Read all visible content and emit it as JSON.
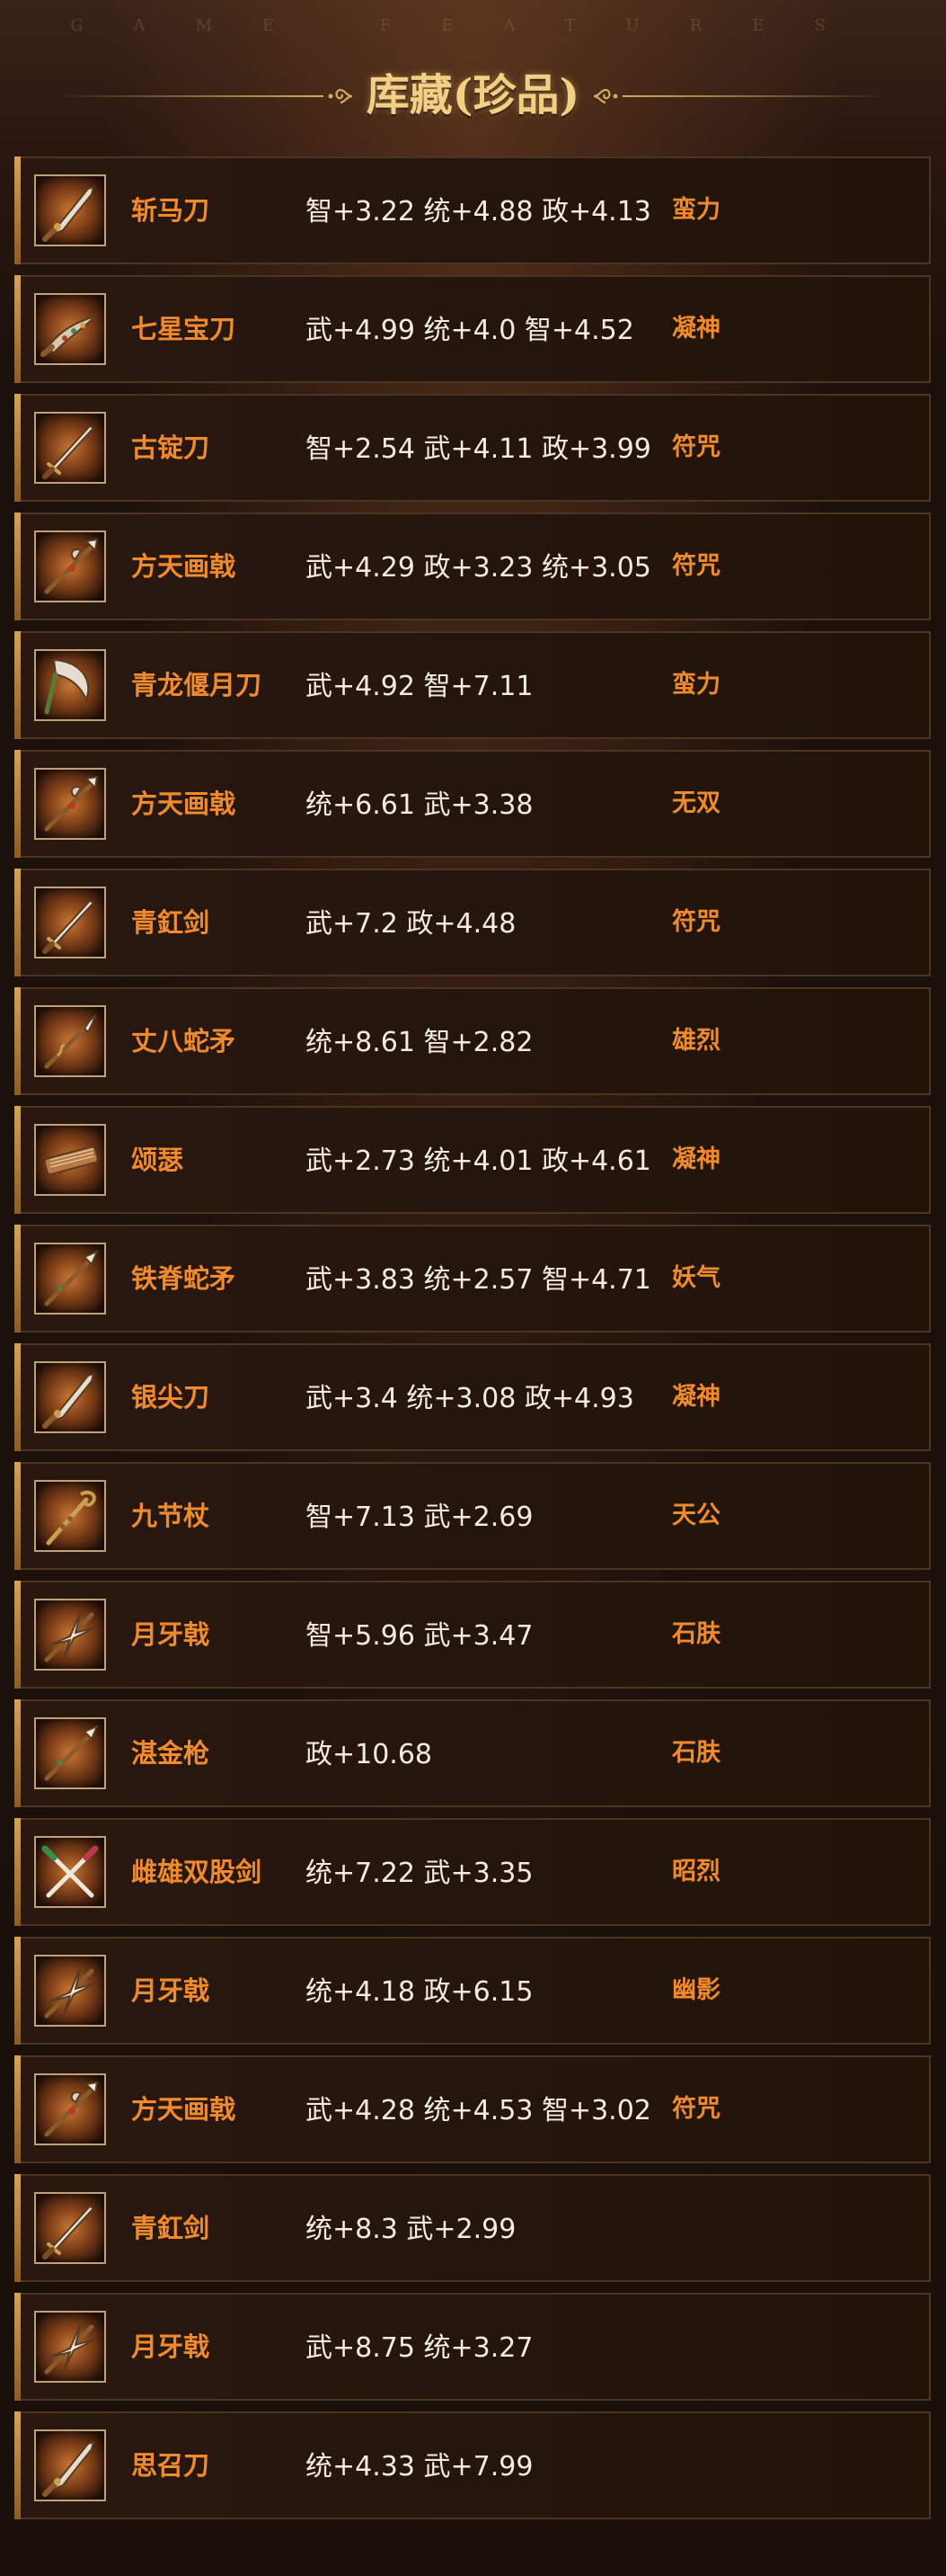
{
  "header": {
    "watermark": "GAME FEATURES",
    "title": "库藏(珍品)"
  },
  "items": [
    {
      "name": "斩马刀",
      "stats": "智+3.22 统+4.88 政+4.13",
      "trait": "蛮力",
      "icon": "blade-icon"
    },
    {
      "name": "七星宝刀",
      "stats": "武+4.99 统+4.0 智+4.52",
      "trait": "凝神",
      "icon": "jeweled-sword-icon"
    },
    {
      "name": "古锭刀",
      "stats": "智+2.54 武+4.11 政+3.99",
      "trait": "符咒",
      "icon": "sword-icon"
    },
    {
      "name": "方天画戟",
      "stats": "武+4.29 政+3.23 统+3.05",
      "trait": "符咒",
      "icon": "halberd-icon"
    },
    {
      "name": "青龙偃月刀",
      "stats": "武+4.92 智+7.11",
      "trait": "蛮力",
      "icon": "crescent-blade-icon"
    },
    {
      "name": "方天画戟",
      "stats": "统+6.61 武+3.38",
      "trait": "无双",
      "icon": "halberd-icon"
    },
    {
      "name": "青釭剑",
      "stats": "武+7.2 政+4.48",
      "trait": "符咒",
      "icon": "sword-icon"
    },
    {
      "name": "丈八蛇矛",
      "stats": "统+8.61 智+2.82",
      "trait": "雄烈",
      "icon": "serpent-spear-icon"
    },
    {
      "name": "颂瑟",
      "stats": "武+2.73 统+4.01 政+4.61",
      "trait": "凝神",
      "icon": "zither-icon"
    },
    {
      "name": "铁脊蛇矛",
      "stats": "武+3.83 统+2.57 智+4.71",
      "trait": "妖气",
      "icon": "spear-icon"
    },
    {
      "name": "银尖刀",
      "stats": "武+3.4 统+3.08 政+4.93",
      "trait": "凝神",
      "icon": "blade-icon"
    },
    {
      "name": "九节杖",
      "stats": "智+7.13 武+2.69",
      "trait": "天公",
      "icon": "staff-icon"
    },
    {
      "name": "月牙戟",
      "stats": "智+5.96 武+3.47",
      "trait": "石肤",
      "icon": "crescent-halberd-icon"
    },
    {
      "name": "湛金枪",
      "stats": "政+10.68",
      "trait": "石肤",
      "icon": "spear-icon"
    },
    {
      "name": "雌雄双股剑",
      "stats": "统+7.22 武+3.35",
      "trait": "昭烈",
      "icon": "twin-swords-icon"
    },
    {
      "name": "月牙戟",
      "stats": "统+4.18 政+6.15",
      "trait": "幽影",
      "icon": "crescent-halberd-icon"
    },
    {
      "name": "方天画戟",
      "stats": "武+4.28 统+4.53 智+3.02",
      "trait": "符咒",
      "icon": "halberd-icon"
    },
    {
      "name": "青釭剑",
      "stats": "统+8.3 武+2.99",
      "trait": "",
      "icon": "sword-icon"
    },
    {
      "name": "月牙戟",
      "stats": "武+8.75 统+3.27",
      "trait": "",
      "icon": "crescent-halberd-icon"
    },
    {
      "name": "思召刀",
      "stats": "统+4.33 武+7.99",
      "trait": "",
      "icon": "blade-icon"
    }
  ],
  "colors": {
    "name": "#ef8a2e",
    "trait": "#ef8a2e",
    "stats": "#f4ece2",
    "title": "#f3cf86",
    "accent": "#d2a35a"
  }
}
